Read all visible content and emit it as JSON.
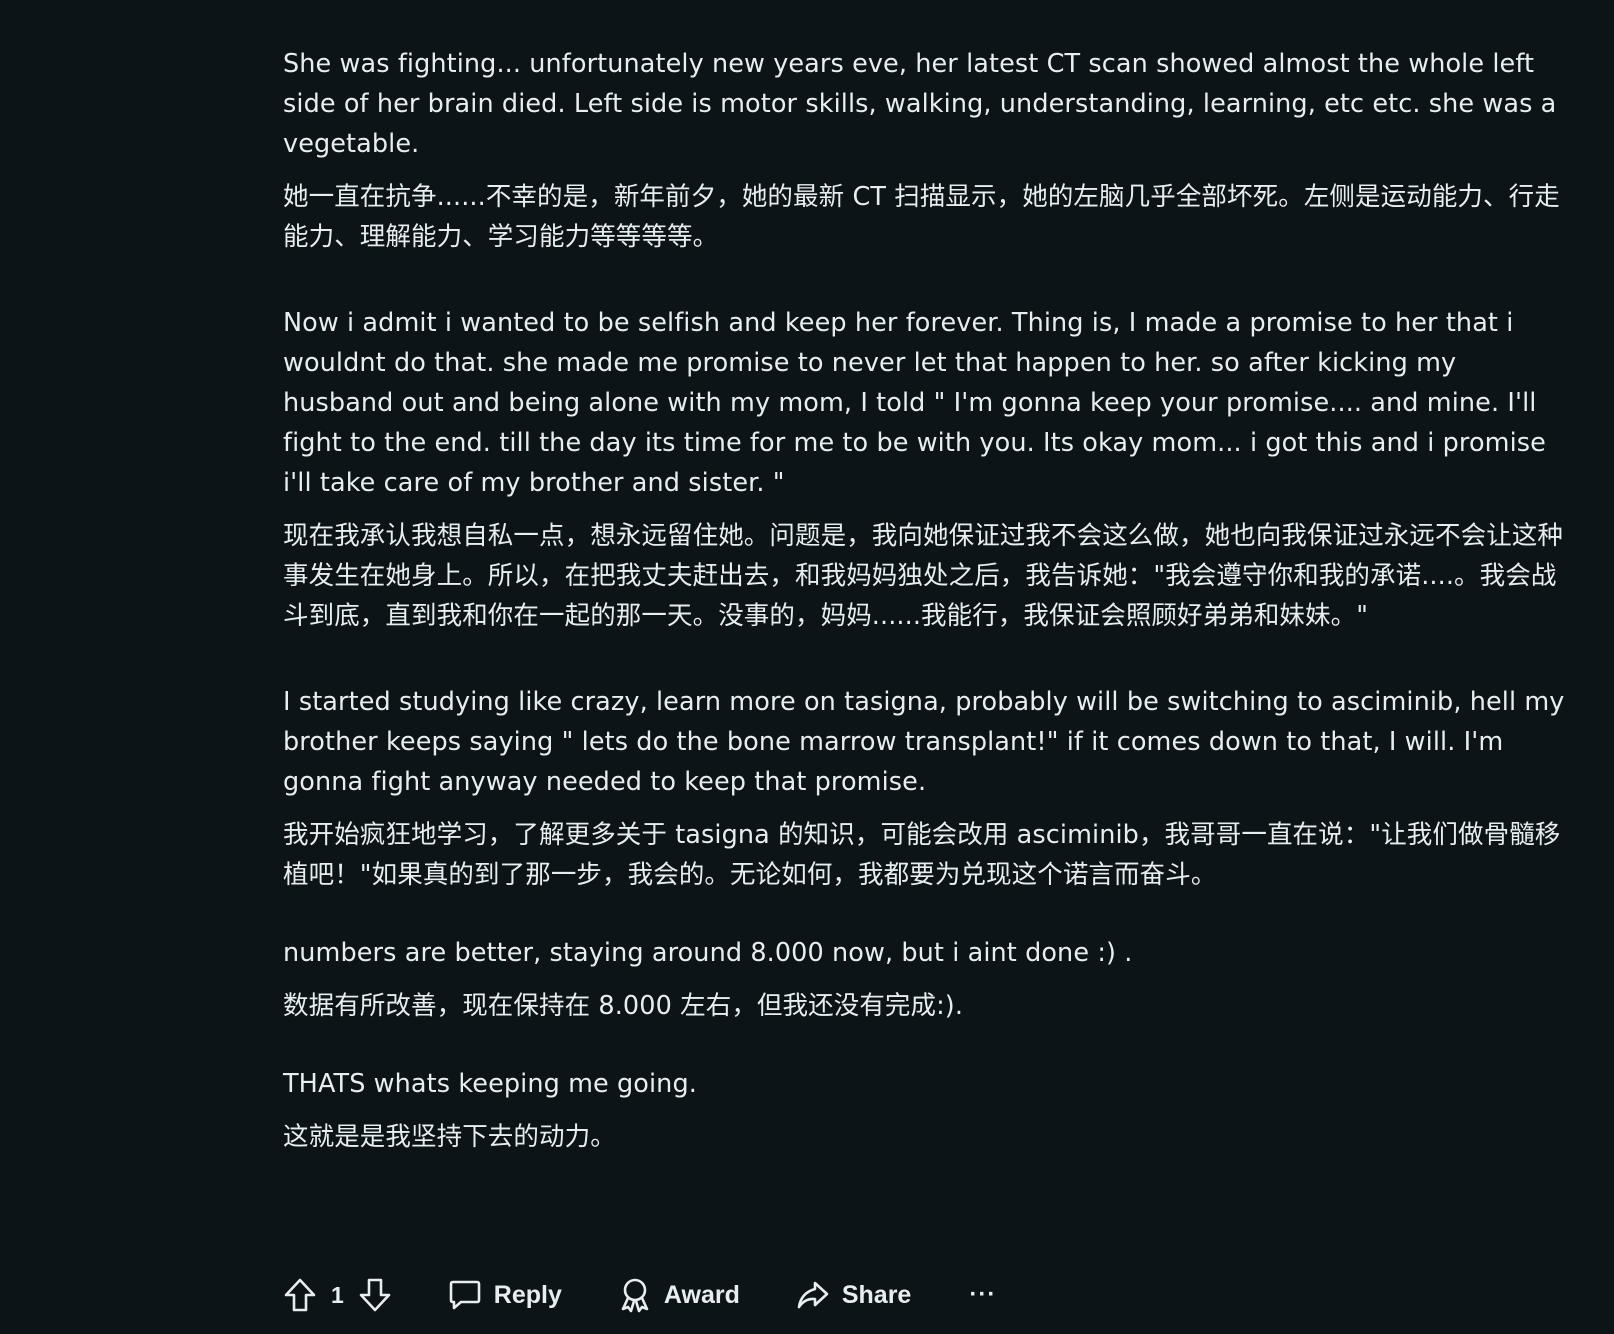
{
  "comment": {
    "paragraphs": [
      "She was fighting... unfortunately new years eve, her latest CT scan showed almost the whole left side of her brain died. Left side is motor skills, walking, understanding, learning, etc etc. she was a vegetable.",
      "她一直在抗争......不幸的是，新年前夕，她的最新 CT 扫描显示，她的左脑几乎全部坏死。左侧是运动能力、行走能力、理解能力、学习能力等等等等。",
      "Now i admit i wanted to be selfish and keep her forever. Thing is, I made a promise to her that i wouldnt do that. she made me promise to never let that happen to her. so after kicking my husband out and being alone with my mom, I told \" I'm gonna keep your promise.... and mine. I'll fight to the end. till the day its time for me to be with you. Its okay mom... i got this and i promise i'll take care of my brother and sister. \"",
      "现在我承认我想自私一点，想永远留住她。问题是，我向她保证过我不会这么做，她也向我保证过永远不会让这种事发生在她身上。所以，在把我丈夫赶出去，和我妈妈独处之后，我告诉她：\"我会遵守你和我的承诺....。我会战斗到底，直到我和你在一起的那一天。没事的，妈妈......我能行，我保证会照顾好弟弟和妹妹。\"",
      "I started studying like crazy, learn more on tasigna, probably will be switching to asciminib, hell my brother keeps saying \" lets do the bone marrow transplant!\" if it comes down to that, I will. I'm gonna fight anyway needed to keep that promise.",
      "我开始疯狂地学习，了解更多关于 tasigna 的知识，可能会改用 asciminib，我哥哥一直在说：\"让我们做骨髓移植吧！\"如果真的到了那一步，我会的。无论如何，我都要为兑现这个诺言而奋斗。",
      "numbers are better, staying around 8.000 now, but i aint done :) .",
      "数据有所改善，现在保持在 8.000 左右，但我还没有完成:).",
      "THATS whats keeping me going.",
      "这就是是我坚持下去的动力。"
    ]
  },
  "actions": {
    "vote_count": "1",
    "reply_label": "Reply",
    "award_label": "Award",
    "share_label": "Share",
    "more_label": "···"
  },
  "icons": {
    "upvote": "arrow-up-icon",
    "downvote": "arrow-down-icon",
    "reply": "comment-bubble-icon",
    "award": "award-ribbon-icon",
    "share": "share-arrow-icon"
  },
  "colors": {
    "background": "#0b1416",
    "text": "#e8edef"
  }
}
